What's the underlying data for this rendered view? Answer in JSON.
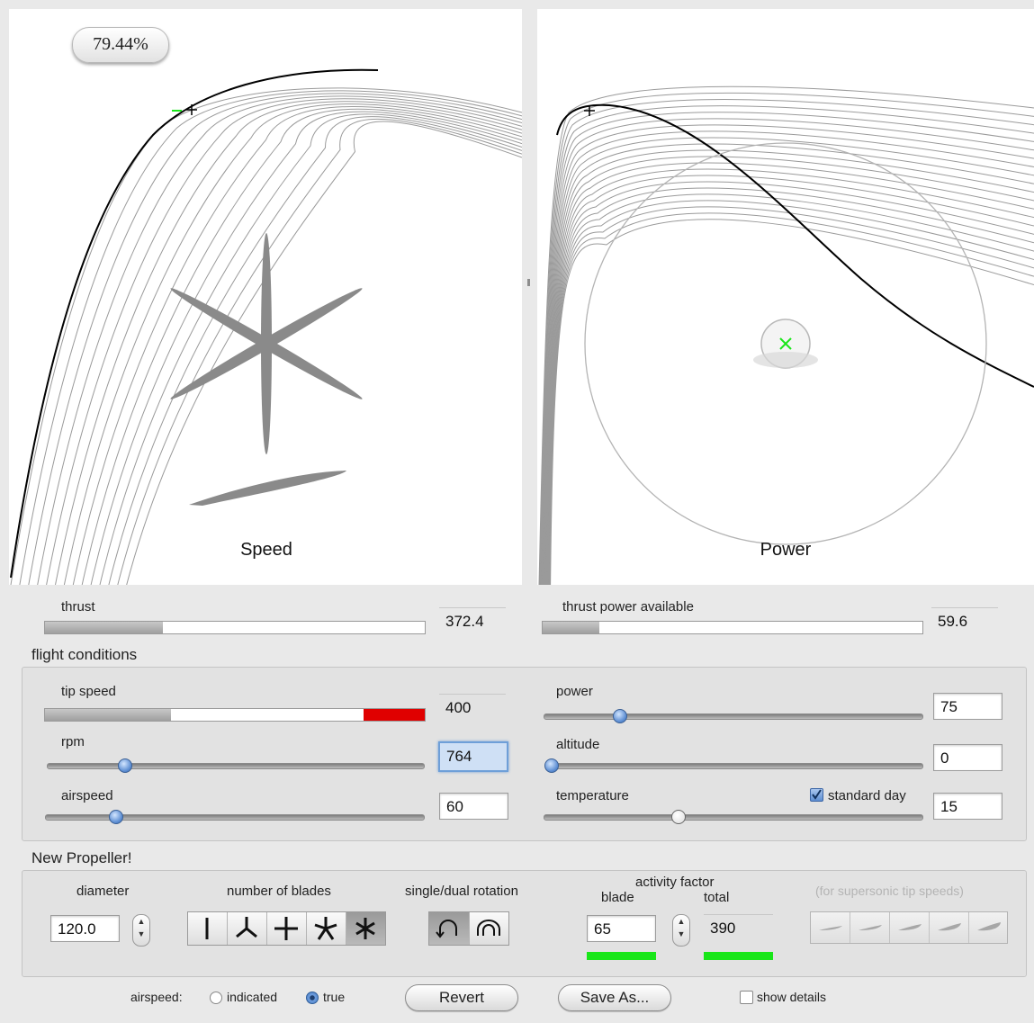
{
  "readout": {
    "percent": "79.44%"
  },
  "plots": {
    "left_title": "Speed",
    "right_title": "Power"
  },
  "results": {
    "thrust": {
      "label": "thrust",
      "value": "372.4",
      "level": 0.31
    },
    "thrust_power": {
      "label": "thrust power available",
      "value": "59.6",
      "level": 0.15
    }
  },
  "flight": {
    "title": "flight conditions",
    "tip_speed": {
      "label": "tip speed",
      "value": "400"
    },
    "rpm": {
      "label": "rpm",
      "value": "764"
    },
    "airspeed": {
      "label": "airspeed",
      "value": "60"
    },
    "power": {
      "label": "power",
      "value": "75"
    },
    "altitude": {
      "label": "altitude",
      "value": "0"
    },
    "temperature": {
      "label": "temperature",
      "value": "15"
    },
    "standard_day": {
      "label": "standard day",
      "checked": true
    }
  },
  "propeller": {
    "title": "New Propeller!",
    "diameter": {
      "label": "diameter",
      "value": "120.0"
    },
    "blades_label": "number of blades",
    "blades_options": [
      "1",
      "3",
      "4",
      "5",
      "6"
    ],
    "blades_selected": "6",
    "rotation_label": "single/dual rotation",
    "rotation_options": [
      "single",
      "dual"
    ],
    "rotation_selected": "single",
    "activity_label": "activity factor",
    "blade_label": "blade",
    "total_label": "total",
    "blade_value": "65",
    "total_value": "390",
    "supersonic_label": "(for supersonic tip speeds)"
  },
  "footer": {
    "airspeed_label": "airspeed:",
    "indicated_label": "indicated",
    "true_label": "true",
    "airspeed_mode": "true",
    "revert_label": "Revert",
    "saveas_label": "Save As...",
    "details_label": "show details",
    "details_checked": false
  },
  "colors": {
    "accent_blue": "#5d8ed3",
    "green_meter": "#19e619",
    "red_zone": "#e00000"
  }
}
